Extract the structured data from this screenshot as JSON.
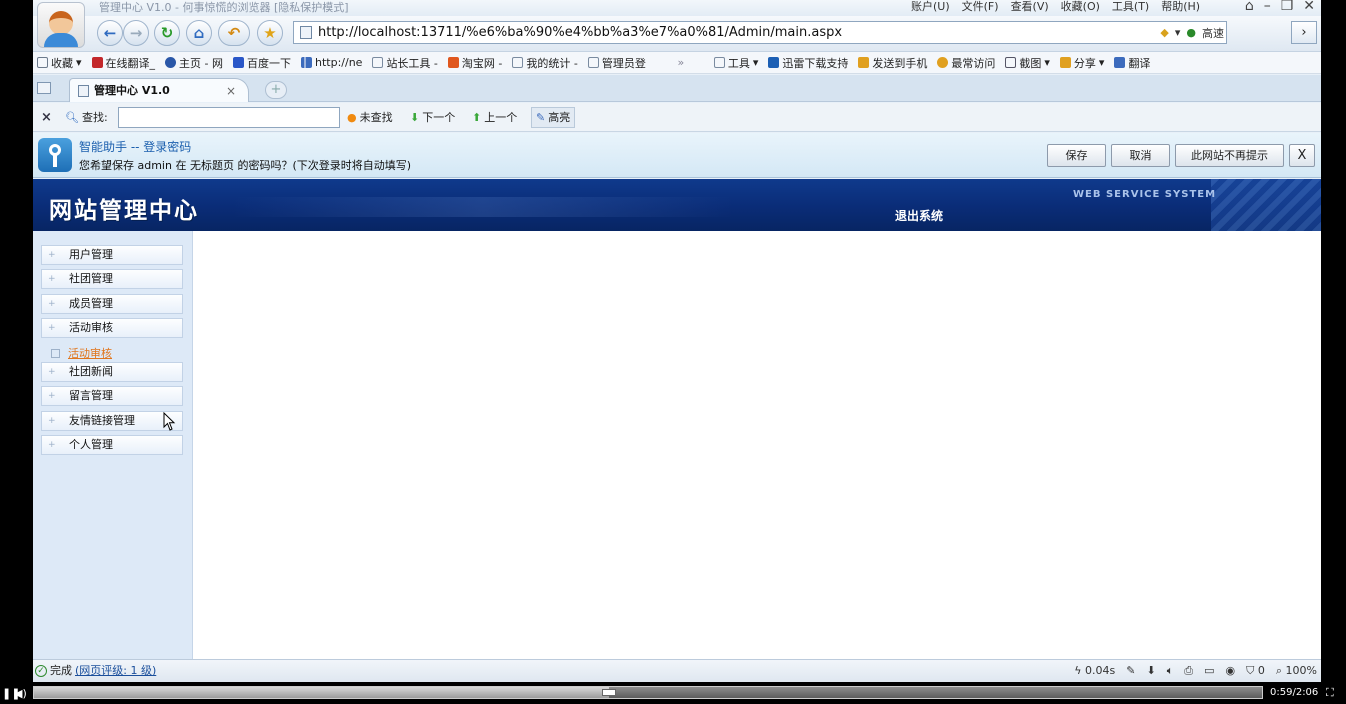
{
  "window": {
    "title": "管理中心 V1.0 - 何事惊慌的浏览器 [隐私保护模式]",
    "menus": [
      "账户(U)",
      "文件(F)",
      "查看(V)",
      "收藏(O)",
      "工具(T)",
      "帮助(H)"
    ]
  },
  "addressbar": {
    "url": "http://localhost:13711/%e6%ba%90%e4%bb%a3%e7%a0%81/Admin/main.aspx",
    "speed_label": "高速",
    "go_label": "›"
  },
  "favorites": {
    "items": [
      {
        "label": "收藏",
        "icon": "star-plus-icon",
        "color": "#6c7a8c"
      },
      {
        "label": "在线翻译_",
        "icon": "y-logo-icon",
        "color": "#c3272b"
      },
      {
        "label": "主页 - 网",
        "icon": "swirl-icon",
        "color": "#2a57a8"
      },
      {
        "label": "百度一下",
        "icon": "paw-icon",
        "color": "#2a57c8"
      },
      {
        "label": "http://ne",
        "icon": "bar-chart-icon",
        "color": "#3c6bbd"
      },
      {
        "label": "站长工具 -",
        "icon": "page-icon",
        "color": "#7a8ba0"
      },
      {
        "label": "淘宝网 -",
        "icon": "taobao-icon",
        "color": "#e0571e"
      },
      {
        "label": "我的统计 -",
        "icon": "page-icon",
        "color": "#7a8ba0"
      },
      {
        "label": "管理员登",
        "icon": "page-icon",
        "color": "#7a8ba0"
      }
    ],
    "overflow": "»",
    "tools": [
      {
        "label": "工具",
        "icon": "tools-icon",
        "color": "#7a8ba0"
      },
      {
        "label": "迅雷下载支持",
        "icon": "thunder-icon",
        "color": "#1c5fb4"
      },
      {
        "label": "发送到手机",
        "icon": "phone-icon",
        "color": "#e0a020"
      },
      {
        "label": "最常访问",
        "icon": "frequent-icon",
        "color": "#e0a020"
      },
      {
        "label": "截图",
        "icon": "screenshot-icon",
        "color": "#556"
      },
      {
        "label": "分享",
        "icon": "share-icon",
        "color": "#e0a020"
      },
      {
        "label": "翻译",
        "icon": "translate-icon",
        "color": "#3c6bbd"
      }
    ]
  },
  "tabs": {
    "active_label": "管理中心 V1.0",
    "close_label": "×",
    "new_tab_label": "+"
  },
  "findbar": {
    "close": "×",
    "label": "查找:",
    "value": "",
    "not_found": "未查找",
    "next": "下一个",
    "prev": "上一个",
    "highlight": "高亮"
  },
  "password_helper": {
    "title": "智能助手 -- 登录密码",
    "message": "您希望保存 admin 在 无标题页 的密码吗？(下次登录时将自动填写)",
    "save": "保存",
    "cancel": "取消",
    "never": "此网站不再提示",
    "close": "X"
  },
  "site": {
    "title": "网站管理中心",
    "tagline": "WEB SERVICE SYSTEM",
    "logout": "退出系统"
  },
  "sidebar": {
    "items": [
      {
        "label": "用户管理"
      },
      {
        "label": "社团管理"
      },
      {
        "label": "成员管理"
      },
      {
        "label": "活动审核"
      }
    ],
    "sub_link": "活动审核",
    "items2": [
      {
        "label": "社团新闻"
      },
      {
        "label": "留言管理"
      },
      {
        "label": "友情链接管理"
      },
      {
        "label": "个人管理"
      }
    ]
  },
  "statusbar": {
    "status": "完成",
    "rank": "(网页评级: 1 级)",
    "time": "0.04s",
    "count": "0",
    "zoom": "100%"
  },
  "player": {
    "timecode": "0:59/2:06",
    "progress_fraction": 0.468
  }
}
